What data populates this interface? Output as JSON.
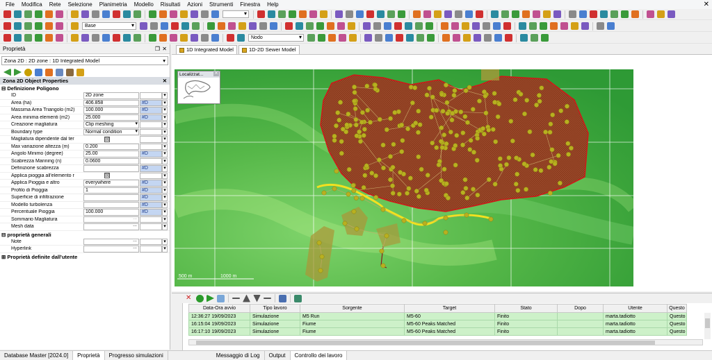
{
  "menu": [
    "File",
    "Modifica",
    "Rete",
    "Selezione",
    "Planimetria",
    "Modello",
    "Risultati",
    "Azioni",
    "Strumenti",
    "Finestra",
    "Help"
  ],
  "toolbar2": {
    "layer_combo": "Base"
  },
  "toolbar3": {
    "node_combo": "Nodo"
  },
  "properties": {
    "title": "Proprietà",
    "zone_selector": "Zona 2D : 2D zone : 1D Integrated Model",
    "object_title": "Zona 2D Object Properties",
    "section_polygon": "Definizione Poligono",
    "rows": [
      {
        "label": "ID",
        "value": "2D zone",
        "flag": ""
      },
      {
        "label": "Area (ha)",
        "value": "406.858",
        "flag": "#D"
      },
      {
        "label": "Massima Area Triangolo (m2)",
        "value": "100.000",
        "flag": "#D"
      },
      {
        "label": "Area minima elementi (m2)",
        "value": "25.000",
        "flag": "#D"
      },
      {
        "label": "Creazione magliatura",
        "value": "Clip meshing",
        "flag": ""
      },
      {
        "label": "Boundary type",
        "value": "Normal condition",
        "flag": ""
      },
      {
        "label": "Magliatura dipendente dal ter",
        "value": "",
        "flag": ""
      },
      {
        "label": "Max variazione altezza (m)",
        "value": "0.200",
        "flag": ""
      },
      {
        "label": "Angolo Minimo (degree)",
        "value": "25.00",
        "flag": "#D"
      },
      {
        "label": "Scabrezza Manning (n)",
        "value": "0.0600",
        "flag": ""
      },
      {
        "label": "Definizione scabrezza",
        "value": "",
        "flag": "#D"
      },
      {
        "label": "Applica pioggia all'elemento r",
        "value": "",
        "flag": ""
      },
      {
        "label": "Applica Pioggia e altro",
        "value": "everywhere",
        "flag": "#D"
      },
      {
        "label": "Profilo di Pioggia",
        "value": "1",
        "flag": "#D"
      },
      {
        "label": "Superficie di infiltrazione",
        "value": "",
        "flag": "#D"
      },
      {
        "label": "Modello turbolenza",
        "value": "",
        "flag": "#D"
      },
      {
        "label": "Percentuale Pioggia",
        "value": "100.000",
        "flag": "#D"
      },
      {
        "label": "Sommario Magliatura",
        "value": "",
        "flag": ""
      },
      {
        "label": "Mesh data",
        "value": "",
        "flag": ""
      }
    ],
    "section_general": "proprietà generali",
    "general_rows": [
      {
        "label": "Note",
        "value": ""
      },
      {
        "label": "Hyperlink",
        "value": ""
      }
    ],
    "section_user": "Proprietà definite dall'utente"
  },
  "doc_tabs": [
    "1D Integrated Model",
    "1D-2D Sewer Model"
  ],
  "locator_title": "Localizzat...",
  "scale_labels": [
    "500 m",
    "1000 m"
  ],
  "jobs": {
    "columns": [
      "Data-Ora avvio",
      "Tipo lavoro",
      "Sorgente",
      "Target",
      "Stato",
      "Dopo",
      "Utente",
      "Questo"
    ],
    "rows": [
      [
        "12:36:27 19/09/2023",
        "Simulazione",
        "M5 Run",
        "M5-60",
        "Finito",
        "",
        "marta.tadiotto",
        "Questo"
      ],
      [
        "16:15:04 19/09/2023",
        "Simulazione",
        "Fiume",
        "M5-60 Peaks Matched",
        "Finito",
        "",
        "marta.tadiotto",
        "Questo"
      ],
      [
        "16:17:10 19/09/2023",
        "Simulazione",
        "Fiume",
        "M5-60 Peaks Matched",
        "Finito",
        "",
        "marta.tadiotto",
        "Questo"
      ]
    ]
  },
  "bottom_tabs": [
    "Database Master [2024.0]",
    "Proprietà",
    "Progresso simulazioni",
    "Messaggio di Log",
    "Output",
    "Controllo dei lavoro"
  ]
}
